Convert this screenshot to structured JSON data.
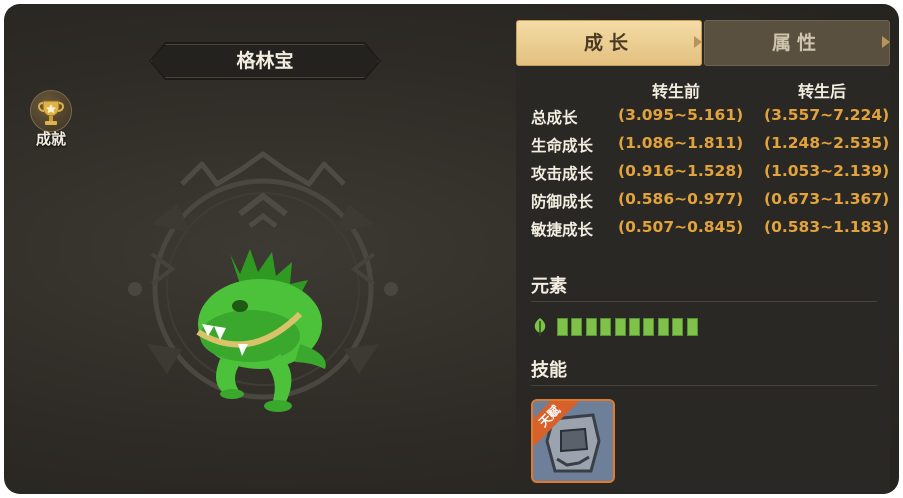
{
  "pet": {
    "name": "格林宝"
  },
  "achievement": {
    "label": "成就",
    "icon": "trophy-icon"
  },
  "tabs": [
    {
      "label": "成长",
      "active": true
    },
    {
      "label": "属性",
      "active": false
    }
  ],
  "growth": {
    "headers": {
      "before": "转生前",
      "after": "转生后"
    },
    "rows": [
      {
        "label": "总成长",
        "before": "(3.095~5.161)",
        "after": "(3.557~7.224)"
      },
      {
        "label": "生命成长",
        "before": "(1.086~1.811)",
        "after": "(1.248~2.535)"
      },
      {
        "label": "攻击成长",
        "before": "(0.916~1.528)",
        "after": "(1.053~2.139)"
      },
      {
        "label": "防御成长",
        "before": "(0.586~0.977)",
        "after": "(0.673~1.367)"
      },
      {
        "label": "敏捷成长",
        "before": "(0.507~0.845)",
        "after": "(0.583~1.183)"
      }
    ]
  },
  "element": {
    "title": "元素",
    "icon": "leaf-icon",
    "level": 10,
    "color": "#7ec24a"
  },
  "skills": {
    "title": "技能",
    "items": [
      {
        "badge": "天赋",
        "icon": "stone-golem-icon"
      }
    ]
  },
  "colors": {
    "accent_tab": "#e3c07f",
    "value_text": "#e3a33c",
    "skill_border": "#e07a2f"
  }
}
